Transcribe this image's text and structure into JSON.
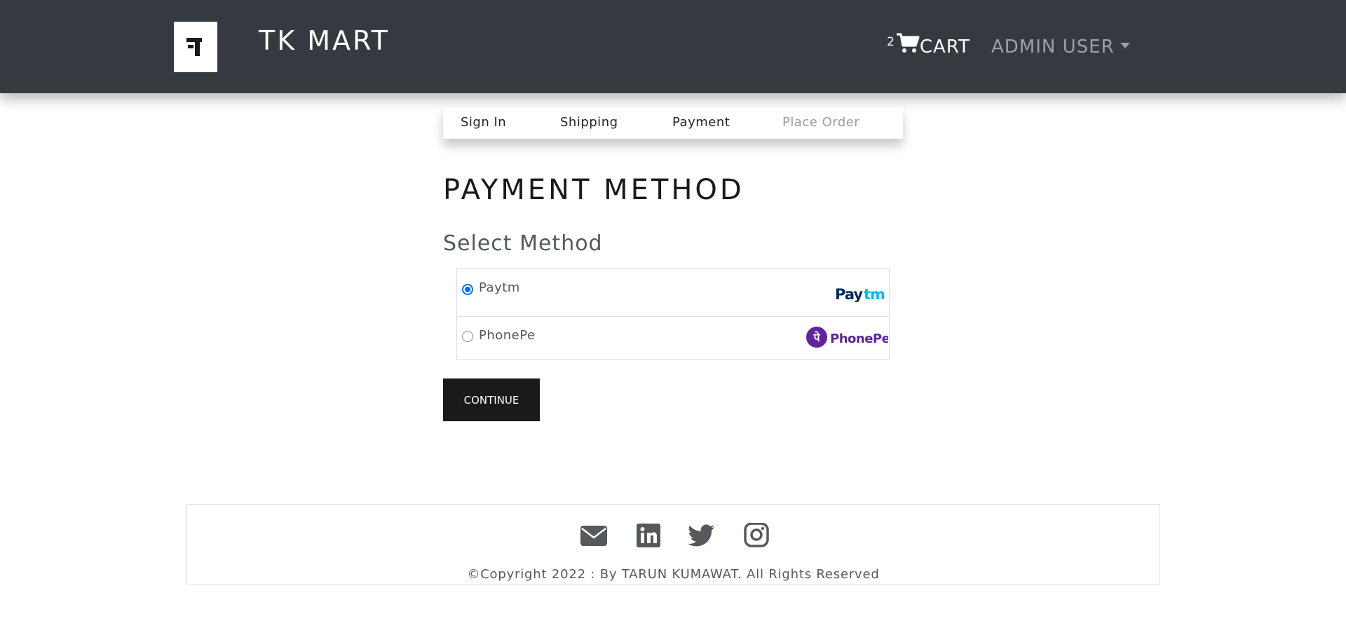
{
  "header": {
    "brand": "TK MART",
    "logo_letter": "T",
    "cart_count": "2",
    "cart_label": "CART",
    "user_label": "ADMIN USER"
  },
  "steps": [
    "Sign In",
    "Shipping",
    "Payment",
    "Place Order"
  ],
  "main": {
    "title": "PAYMENT METHOD",
    "subtitle": "Select Method",
    "methods": [
      {
        "label": "Paytm",
        "checked": true,
        "logo_text": "Paytm"
      },
      {
        "label": "PhonePe",
        "checked": false,
        "logo_text": "PhonePe",
        "logo_mark": "पे"
      }
    ],
    "continue_label": "CONTINUE"
  },
  "footer": {
    "icons": [
      "envelope-icon",
      "linkedin-icon",
      "twitter-icon",
      "instagram-icon"
    ],
    "copyright": "©Copyright 2022 : By TARUN KUMAWAT. All Rights Reserved"
  },
  "colors": {
    "navbar": "#343a40",
    "button": "#1a1a1a",
    "radio_accent": "#0b6efd",
    "paytm_dark": "#00295f",
    "paytm_light": "#00baf2",
    "phonepe": "#5f259f"
  }
}
